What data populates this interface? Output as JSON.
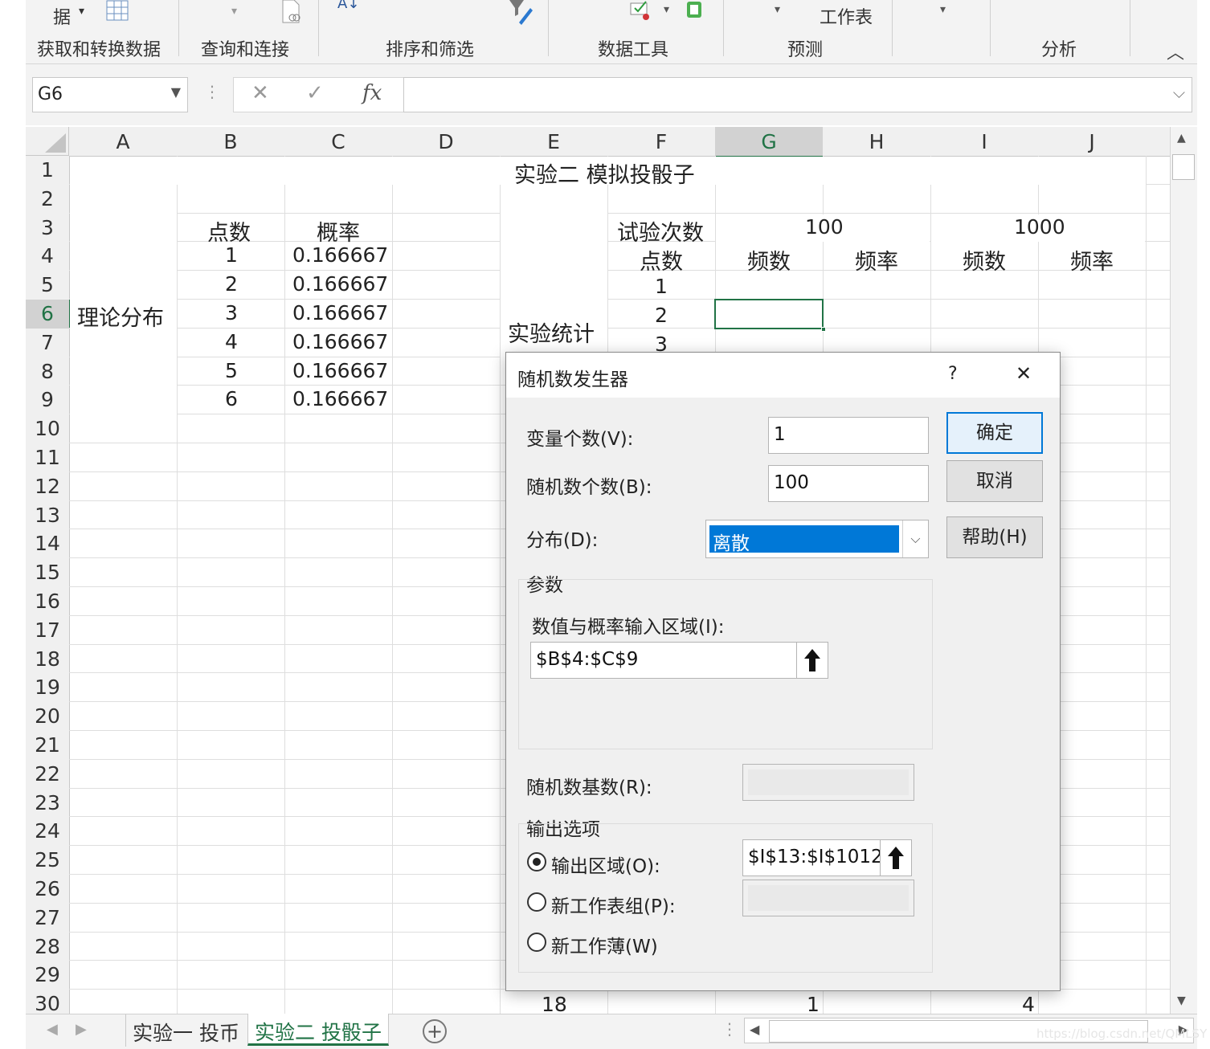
{
  "ribbon": {
    "top_text_left": "据",
    "top_text_worksheet": "工作表",
    "groups": [
      "获取和转换数据",
      "查询和连接",
      "排序和筛选",
      "数据工具",
      "预测",
      "分析"
    ]
  },
  "formula_bar": {
    "name_box": "G6",
    "cancel_glyph": "✕",
    "enter_glyph": "✓",
    "fx_label": "fx",
    "formula": ""
  },
  "grid": {
    "columns": [
      "A",
      "B",
      "C",
      "D",
      "E",
      "F",
      "G",
      "H",
      "I",
      "J"
    ],
    "rows": [
      "1",
      "2",
      "3",
      "4",
      "5",
      "6",
      "7",
      "8",
      "9",
      "10",
      "11",
      "12",
      "13",
      "14",
      "15",
      "16",
      "17",
      "18",
      "19",
      "20",
      "21",
      "22",
      "23",
      "24",
      "25",
      "26",
      "27",
      "28",
      "29",
      "30"
    ],
    "selected_cell": "G6",
    "title": "实验二 模拟投骰子",
    "theory_label": "理论分布",
    "theory_headers": [
      "点数",
      "概率"
    ],
    "theory_points": [
      "1",
      "2",
      "3",
      "4",
      "5",
      "6"
    ],
    "theory_probs": [
      "0.166667",
      "0.166667",
      "0.166667",
      "0.166667",
      "0.166667",
      "0.166667"
    ],
    "experiment_label": "实验统计",
    "trials_label": "试验次数",
    "trials_100": "100",
    "trials_1000": "1000",
    "points_label": "点数",
    "freq_count_label": "频数",
    "freq_rate_label": "频率",
    "exp_points": [
      "1",
      "2",
      "3"
    ],
    "row30": {
      "E": "18",
      "G": "1",
      "I": "4"
    }
  },
  "sheet_tabs": [
    "实验一 投币",
    "实验二 投骰子"
  ],
  "active_tab": "实验二 投骰子",
  "dialog": {
    "title": "随机数发生器",
    "help_glyph": "?",
    "close_glyph": "✕",
    "num_variables_label": "变量个数(V):",
    "num_variables_value": "1",
    "num_random_label": "随机数个数(B):",
    "num_random_value": "100",
    "distribution_label": "分布(D):",
    "distribution_value": "离散",
    "params_label": "参数",
    "value_prob_range_label": "数值与概率输入区域(I):",
    "value_prob_range_value": "$B$4:$C$9",
    "seed_label": "随机数基数(R):",
    "seed_value": "",
    "output_options_label": "输出选项",
    "output_range_label": "输出区域(O):",
    "output_range_value": "$I$13:$I$1012",
    "new_sheet_label": "新工作表组(P):",
    "new_sheet_value": "",
    "new_workbook_label": "新工作薄(W)",
    "output_choice": "输出区域(O):",
    "ok_label": "确定",
    "cancel_label": "取消",
    "help_label": "帮助(H)"
  },
  "watermark": "https://blog.csdn.net/QMLSY",
  "colors": {
    "selection_green": "#217346",
    "dropdown_highlight": "#0078d7",
    "ribbon_bg": "#f3f3f3"
  }
}
